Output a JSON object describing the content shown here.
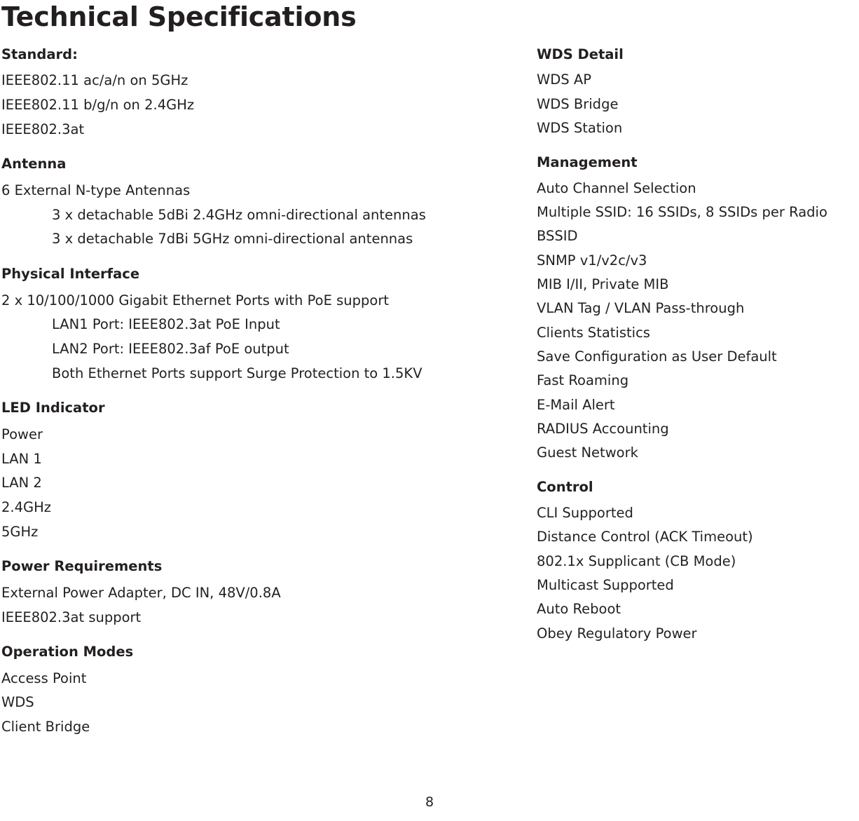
{
  "document": {
    "title": "Technical Specifications",
    "page_number": "8"
  },
  "left_column": [
    {
      "heading": "Standard:",
      "lines": [
        {
          "text": "IEEE802.11 ac/a/n on 5GHz",
          "indent": false
        },
        {
          "text": "IEEE802.11 b/g/n on 2.4GHz",
          "indent": false
        },
        {
          "text": "IEEE802.3at",
          "indent": false
        }
      ]
    },
    {
      "heading": "Antenna",
      "lines": [
        {
          "text": "6 External N-type Antennas",
          "indent": false
        },
        {
          "text": "3 x detachable 5dBi 2.4GHz omni-directional antennas",
          "indent": true
        },
        {
          "text": "3 x detachable 7dBi 5GHz omni-directional antennas",
          "indent": true
        }
      ]
    },
    {
      "heading": "Physical Interface",
      "lines": [
        {
          "text": "2 x 10/100/1000 Gigabit Ethernet Ports with PoE support",
          "indent": false
        },
        {
          "text": "LAN1 Port: IEEE802.3at PoE Input",
          "indent": true
        },
        {
          "text": "LAN2 Port: IEEE802.3af PoE output",
          "indent": true
        },
        {
          "text": "Both Ethernet Ports support Surge Protection to 1.5KV",
          "indent": true
        }
      ]
    },
    {
      "heading": "LED Indicator",
      "lines": [
        {
          "text": "Power",
          "indent": false
        },
        {
          "text": "LAN 1",
          "indent": false
        },
        {
          "text": "LAN 2",
          "indent": false
        },
        {
          "text": "2.4GHz",
          "indent": false
        },
        {
          "text": "5GHz",
          "indent": false
        }
      ]
    },
    {
      "heading": "Power Requirements",
      "lines": [
        {
          "text": "External Power Adapter, DC IN, 48V/0.8A",
          "indent": false
        },
        {
          "text": "IEEE802.3at support",
          "indent": false
        }
      ]
    },
    {
      "heading": "Operation Modes",
      "lines": [
        {
          "text": "Access Point",
          "indent": false
        },
        {
          "text": "WDS",
          "indent": false
        },
        {
          "text": "Client Bridge",
          "indent": false
        }
      ]
    }
  ],
  "right_column": [
    {
      "heading": "WDS Detail",
      "lines": [
        {
          "text": "WDS AP",
          "indent": false
        },
        {
          "text": "WDS Bridge",
          "indent": false
        },
        {
          "text": "WDS Station",
          "indent": false
        }
      ]
    },
    {
      "heading": "Management",
      "lines": [
        {
          "text": "Auto Channel Selection",
          "indent": false
        },
        {
          "text": "Multiple SSID: 16 SSIDs, 8 SSIDs per Radio",
          "indent": false
        },
        {
          "text": "BSSID",
          "indent": false
        },
        {
          "text": "SNMP v1/v2c/v3",
          "indent": false
        },
        {
          "text": "MIB I/II, Private MIB",
          "indent": false
        },
        {
          "text": "VLAN Tag / VLAN Pass-through",
          "indent": false
        },
        {
          "text": "Clients Statistics",
          "indent": false
        },
        {
          "text": "Save Configuration as User Default",
          "indent": false
        },
        {
          "text": "Fast Roaming",
          "indent": false
        },
        {
          "text": "E-Mail Alert",
          "indent": false
        },
        {
          "text": "RADIUS Accounting",
          "indent": false
        },
        {
          "text": "Guest Network",
          "indent": false
        }
      ]
    },
    {
      "heading": "Control",
      "lines": [
        {
          "text": "CLI Supported",
          "indent": false
        },
        {
          "text": "Distance Control (ACK Timeout)",
          "indent": false
        },
        {
          "text": "802.1x Supplicant (CB Mode)",
          "indent": false
        },
        {
          "text": "Multicast Supported",
          "indent": false
        },
        {
          "text": "Auto Reboot",
          "indent": false
        },
        {
          "text": "Obey Regulatory Power",
          "indent": false
        }
      ]
    }
  ]
}
